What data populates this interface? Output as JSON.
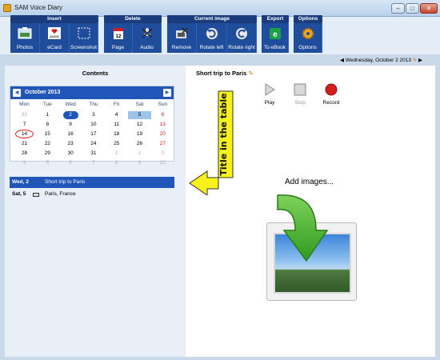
{
  "window": {
    "title": "SAM Voice Diary"
  },
  "toolbar": {
    "groups": [
      {
        "title": "Insert",
        "buttons": [
          {
            "label": "Photos",
            "icon": "photos-icon"
          },
          {
            "label": "eCard",
            "icon": "ecard-icon",
            "icon_text": "[NAME]"
          },
          {
            "label": "Screenshot",
            "icon": "screenshot-icon"
          }
        ]
      },
      {
        "title": "Delete",
        "buttons": [
          {
            "label": "Page",
            "icon": "delete-page-icon",
            "icon_text": "12"
          },
          {
            "label": "Audio",
            "icon": "delete-audio-icon"
          }
        ]
      },
      {
        "title": "Current image",
        "buttons": [
          {
            "label": "Remove",
            "icon": "remove-image-icon"
          },
          {
            "label": "Rotate left",
            "icon": "rotate-left-icon"
          },
          {
            "label": "Rotate right",
            "icon": "rotate-right-icon"
          }
        ]
      },
      {
        "title": "Export",
        "buttons": [
          {
            "label": "To eBook",
            "icon": "ebook-icon"
          }
        ]
      },
      {
        "title": "Options",
        "buttons": [
          {
            "label": "Options",
            "icon": "gear-icon"
          }
        ]
      }
    ]
  },
  "datebar": {
    "date": "Wednesday, October 2 2013"
  },
  "left": {
    "heading": "Contents",
    "calendar": {
      "month": "October 2013",
      "weekdays": [
        "Mon",
        "Tue",
        "Wed",
        "Thu",
        "Fri",
        "Sat",
        "Sun"
      ],
      "weeks": [
        [
          "30",
          "1",
          "2",
          "3",
          "4",
          "5",
          "6"
        ],
        [
          "7",
          "8",
          "9",
          "10",
          "11",
          "12",
          "13"
        ],
        [
          "14",
          "15",
          "16",
          "17",
          "18",
          "19",
          "20"
        ],
        [
          "21",
          "22",
          "23",
          "24",
          "25",
          "26",
          "27"
        ],
        [
          "28",
          "29",
          "30",
          "31",
          "1",
          "2",
          "3"
        ],
        [
          "4",
          "5",
          "6",
          "7",
          "8",
          "9",
          "10"
        ]
      ],
      "selected_day": "2",
      "highlighted_day": "5",
      "today_circled": "14"
    },
    "entries": [
      {
        "day": "Wed, 2",
        "title": "Short trip to Paris",
        "selected": true
      },
      {
        "day": "Sat, 5",
        "title": "Paris, France",
        "selected": false
      }
    ]
  },
  "right": {
    "title": "Short trip to Paris",
    "controls": {
      "play": "Play",
      "stop": "Stop",
      "record": "Record"
    },
    "add_images": "Add images..."
  },
  "callout": {
    "text": "Title in the table"
  },
  "colors": {
    "accent": "#1f56b8",
    "toolbar": "#1f4d9b",
    "group_header": "#1b3c7c",
    "record": "#d21e1e",
    "callout": "#f7f21a"
  }
}
